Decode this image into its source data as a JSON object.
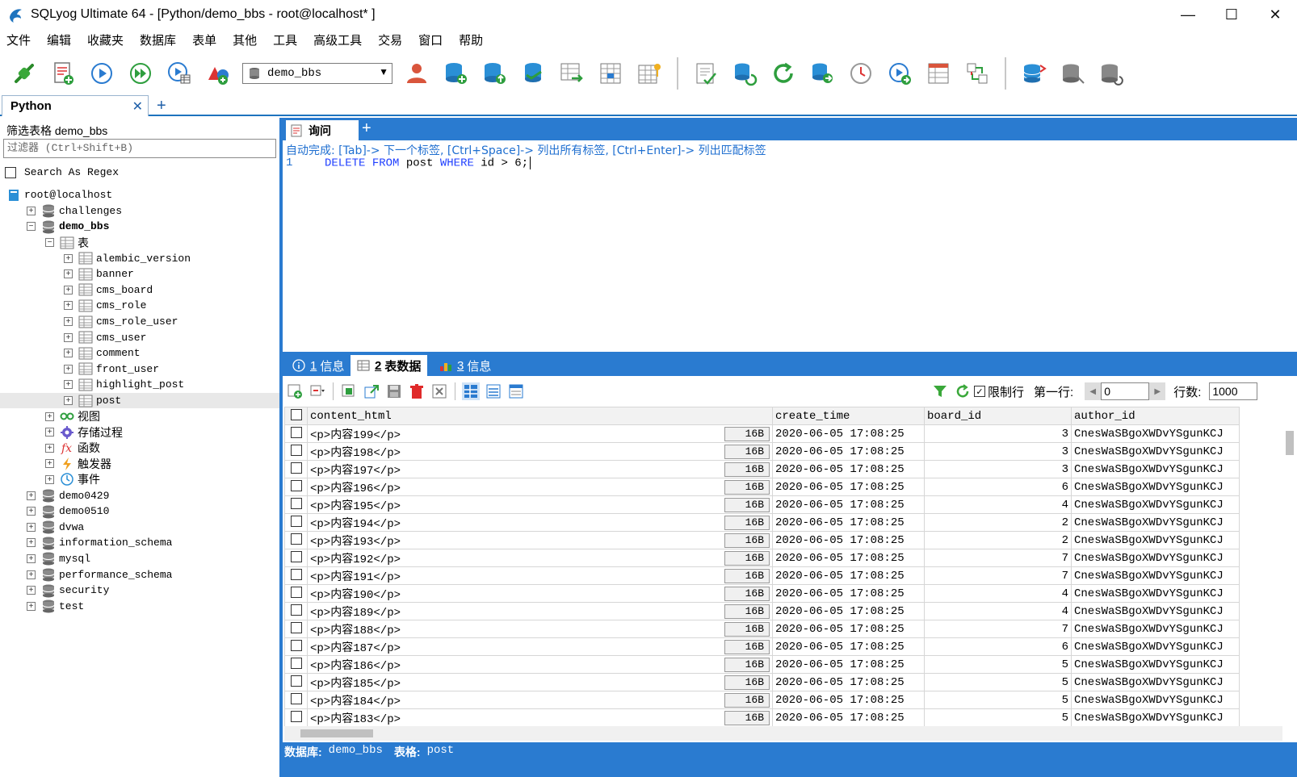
{
  "window": {
    "title": "SQLyog Ultimate 64 - [Python/demo_bbs - root@localhost* ]",
    "minimize": "—",
    "maximize": "☐",
    "close": "✕"
  },
  "menu": [
    "文件",
    "编辑",
    "收藏夹",
    "数据库",
    "表单",
    "其他",
    "工具",
    "高级工具",
    "交易",
    "窗口",
    "帮助"
  ],
  "toolbar": {
    "database_select": "demo_bbs"
  },
  "connection_tab": {
    "label": "Python",
    "close": "✕",
    "add": "+"
  },
  "left_panel": {
    "filter_label": "筛选表格 demo_bbs",
    "filter_placeholder": "过滤器 (Ctrl+Shift+B)",
    "regex_label": "Search As Regex",
    "tree": [
      {
        "label": "root@localhost",
        "depth": 0,
        "icon": "server-icon",
        "exp": ""
      },
      {
        "label": "challenges",
        "depth": 1,
        "icon": "database-icon",
        "exp": "+"
      },
      {
        "label": "demo_bbs",
        "depth": 1,
        "icon": "database-icon",
        "exp": "−",
        "bold": true
      },
      {
        "label": "表",
        "depth": 2,
        "icon": "table-folder-icon",
        "exp": "−",
        "cjk": true
      },
      {
        "label": "alembic_version",
        "depth": 3,
        "icon": "table-icon",
        "exp": "+"
      },
      {
        "label": "banner",
        "depth": 3,
        "icon": "table-icon",
        "exp": "+"
      },
      {
        "label": "cms_board",
        "depth": 3,
        "icon": "table-icon",
        "exp": "+"
      },
      {
        "label": "cms_role",
        "depth": 3,
        "icon": "table-icon",
        "exp": "+"
      },
      {
        "label": "cms_role_user",
        "depth": 3,
        "icon": "table-icon",
        "exp": "+"
      },
      {
        "label": "cms_user",
        "depth": 3,
        "icon": "table-icon",
        "exp": "+"
      },
      {
        "label": "comment",
        "depth": 3,
        "icon": "table-icon",
        "exp": "+"
      },
      {
        "label": "front_user",
        "depth": 3,
        "icon": "table-icon",
        "exp": "+"
      },
      {
        "label": "highlight_post",
        "depth": 3,
        "icon": "table-icon",
        "exp": "+"
      },
      {
        "label": "post",
        "depth": 3,
        "icon": "table-icon",
        "exp": "+",
        "selected": true
      },
      {
        "label": "视图",
        "depth": 2,
        "icon": "view-icon",
        "exp": "+",
        "cjk": true
      },
      {
        "label": "存储过程",
        "depth": 2,
        "icon": "gear-icon",
        "exp": "+",
        "cjk": true
      },
      {
        "label": "函数",
        "depth": 2,
        "icon": "function-icon",
        "exp": "+",
        "cjk": true
      },
      {
        "label": "触发器",
        "depth": 2,
        "icon": "lightning-icon",
        "exp": "+",
        "cjk": true
      },
      {
        "label": "事件",
        "depth": 2,
        "icon": "clock-icon",
        "exp": "+",
        "cjk": true
      },
      {
        "label": "demo0429",
        "depth": 1,
        "icon": "database-icon",
        "exp": "+"
      },
      {
        "label": "demo0510",
        "depth": 1,
        "icon": "database-icon",
        "exp": "+"
      },
      {
        "label": "dvwa",
        "depth": 1,
        "icon": "database-icon",
        "exp": "+"
      },
      {
        "label": "information_schema",
        "depth": 1,
        "icon": "database-icon",
        "exp": "+"
      },
      {
        "label": "mysql",
        "depth": 1,
        "icon": "database-icon",
        "exp": "+"
      },
      {
        "label": "performance_schema",
        "depth": 1,
        "icon": "database-icon",
        "exp": "+"
      },
      {
        "label": "security",
        "depth": 1,
        "icon": "database-icon",
        "exp": "+"
      },
      {
        "label": "test",
        "depth": 1,
        "icon": "database-icon",
        "exp": "+"
      }
    ]
  },
  "query_tab": {
    "label": "询问",
    "add": "+"
  },
  "editor": {
    "autocomplete_hint": "自动完成: [Tab]-> 下一个标签, [Ctrl+Space]-> 列出所有标签, [Ctrl+Enter]-> 列出匹配标签",
    "line_number": "1",
    "sql": {
      "kw1": "DELETE",
      "kw2": "FROM",
      "table": "post",
      "kw3": "WHERE",
      "rest": "id > 6;"
    }
  },
  "result_tabs": [
    {
      "num": "1",
      "label": "信息",
      "icon": "info-icon"
    },
    {
      "num": "2",
      "label": "表数据",
      "icon": "table-icon",
      "active": true
    },
    {
      "num": "3",
      "label": "信息",
      "icon": "chart-icon"
    }
  ],
  "result_toolbar": {
    "limit_label": "限制行",
    "first_row_label": "第一行:",
    "first_row_value": "0",
    "rows_label": "行数:",
    "rows_value": "1000"
  },
  "grid": {
    "columns": [
      "content_html",
      "create_time",
      "board_id",
      "author_id"
    ],
    "rows": [
      {
        "content": "<p>内容199</p>",
        "size": "16B",
        "time": "2020-06-05 17:08:25",
        "board": "3",
        "author": "CnesWaSBgoXWDvYSgunKCJ"
      },
      {
        "content": "<p>内容198</p>",
        "size": "16B",
        "time": "2020-06-05 17:08:25",
        "board": "3",
        "author": "CnesWaSBgoXWDvYSgunKCJ"
      },
      {
        "content": "<p>内容197</p>",
        "size": "16B",
        "time": "2020-06-05 17:08:25",
        "board": "3",
        "author": "CnesWaSBgoXWDvYSgunKCJ"
      },
      {
        "content": "<p>内容196</p>",
        "size": "16B",
        "time": "2020-06-05 17:08:25",
        "board": "6",
        "author": "CnesWaSBgoXWDvYSgunKCJ"
      },
      {
        "content": "<p>内容195</p>",
        "size": "16B",
        "time": "2020-06-05 17:08:25",
        "board": "4",
        "author": "CnesWaSBgoXWDvYSgunKCJ"
      },
      {
        "content": "<p>内容194</p>",
        "size": "16B",
        "time": "2020-06-05 17:08:25",
        "board": "2",
        "author": "CnesWaSBgoXWDvYSgunKCJ"
      },
      {
        "content": "<p>内容193</p>",
        "size": "16B",
        "time": "2020-06-05 17:08:25",
        "board": "2",
        "author": "CnesWaSBgoXWDvYSgunKCJ"
      },
      {
        "content": "<p>内容192</p>",
        "size": "16B",
        "time": "2020-06-05 17:08:25",
        "board": "7",
        "author": "CnesWaSBgoXWDvYSgunKCJ"
      },
      {
        "content": "<p>内容191</p>",
        "size": "16B",
        "time": "2020-06-05 17:08:25",
        "board": "7",
        "author": "CnesWaSBgoXWDvYSgunKCJ"
      },
      {
        "content": "<p>内容190</p>",
        "size": "16B",
        "time": "2020-06-05 17:08:25",
        "board": "4",
        "author": "CnesWaSBgoXWDvYSgunKCJ"
      },
      {
        "content": "<p>内容189</p>",
        "size": "16B",
        "time": "2020-06-05 17:08:25",
        "board": "4",
        "author": "CnesWaSBgoXWDvYSgunKCJ"
      },
      {
        "content": "<p>内容188</p>",
        "size": "16B",
        "time": "2020-06-05 17:08:25",
        "board": "7",
        "author": "CnesWaSBgoXWDvYSgunKCJ"
      },
      {
        "content": "<p>内容187</p>",
        "size": "16B",
        "time": "2020-06-05 17:08:25",
        "board": "6",
        "author": "CnesWaSBgoXWDvYSgunKCJ"
      },
      {
        "content": "<p>内容186</p>",
        "size": "16B",
        "time": "2020-06-05 17:08:25",
        "board": "5",
        "author": "CnesWaSBgoXWDvYSgunKCJ"
      },
      {
        "content": "<p>内容185</p>",
        "size": "16B",
        "time": "2020-06-05 17:08:25",
        "board": "5",
        "author": "CnesWaSBgoXWDvYSgunKCJ"
      },
      {
        "content": "<p>内容184</p>",
        "size": "16B",
        "time": "2020-06-05 17:08:25",
        "board": "5",
        "author": "CnesWaSBgoXWDvYSgunKCJ"
      },
      {
        "content": "<p>内容183</p>",
        "size": "16B",
        "time": "2020-06-05 17:08:25",
        "board": "5",
        "author": "CnesWaSBgoXWDvYSgunKCJ"
      }
    ]
  },
  "status": {
    "db_label": "数据库:",
    "db_value": "demo_bbs",
    "table_label": "表格:",
    "table_value": "post"
  },
  "colors": {
    "accent": "#2a7bd0",
    "keyword": "#1f3fff",
    "hint": "#1f6fd0"
  }
}
